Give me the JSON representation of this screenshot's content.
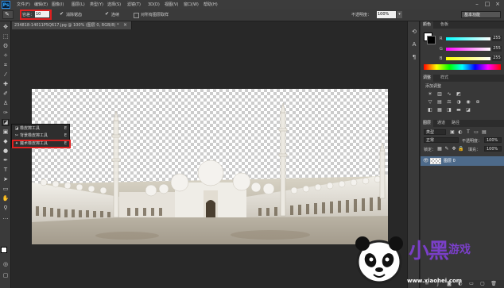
{
  "app": {
    "logo": "Ps"
  },
  "menu": {
    "items": [
      "文件(F)",
      "编辑(E)",
      "图像(I)",
      "图层(L)",
      "类型(Y)",
      "选择(S)",
      "滤镜(T)",
      "3D(D)",
      "视图(V)",
      "窗口(W)",
      "帮助(H)"
    ],
    "window_controls": [
      "–",
      "□",
      "×"
    ]
  },
  "options": {
    "tolerance_label": "容差：",
    "tolerance_value": "10",
    "antialias_label": "消除锯齿",
    "contiguous_label": "连续",
    "sample_all_label": "对所有图层取样",
    "opacity_label": "不透明度：",
    "opacity_value": "100%",
    "workspace": "基本功能"
  },
  "document": {
    "tab_title": "234818-14011P5Q617.jpg @ 100% (图层 0, RGB/8) *",
    "close": "×"
  },
  "flyout": {
    "items": [
      {
        "label": "橡皮擦工具",
        "key": "E",
        "icon": "eraser-icon"
      },
      {
        "label": "背景橡皮擦工具",
        "key": "E",
        "icon": "background-eraser-icon"
      },
      {
        "label": "魔术橡皮擦工具",
        "key": "E",
        "icon": "magic-eraser-icon"
      }
    ]
  },
  "panels": {
    "color_tabs": [
      "颜色",
      "色板"
    ],
    "color_values": {
      "r_label": "R",
      "r": "255",
      "g_label": "G",
      "g": "255",
      "b_label": "B",
      "b": "255"
    },
    "adjust_tabs": [
      "调整",
      "样式"
    ],
    "adjust_title": "添加调整",
    "layer_tabs": [
      "图层",
      "通道",
      "路径"
    ],
    "kind_select": "类型",
    "blend_mode": "正常",
    "opacity_label": "不透明度：",
    "opacity_value": "100%",
    "lock_label": "锁定：",
    "fill_label": "填充：",
    "fill_value": "100%",
    "layer_name": "图层 0"
  },
  "watermark": {
    "main": "小黑",
    "game": "游戏",
    "url": "www.xiaohei.com"
  }
}
